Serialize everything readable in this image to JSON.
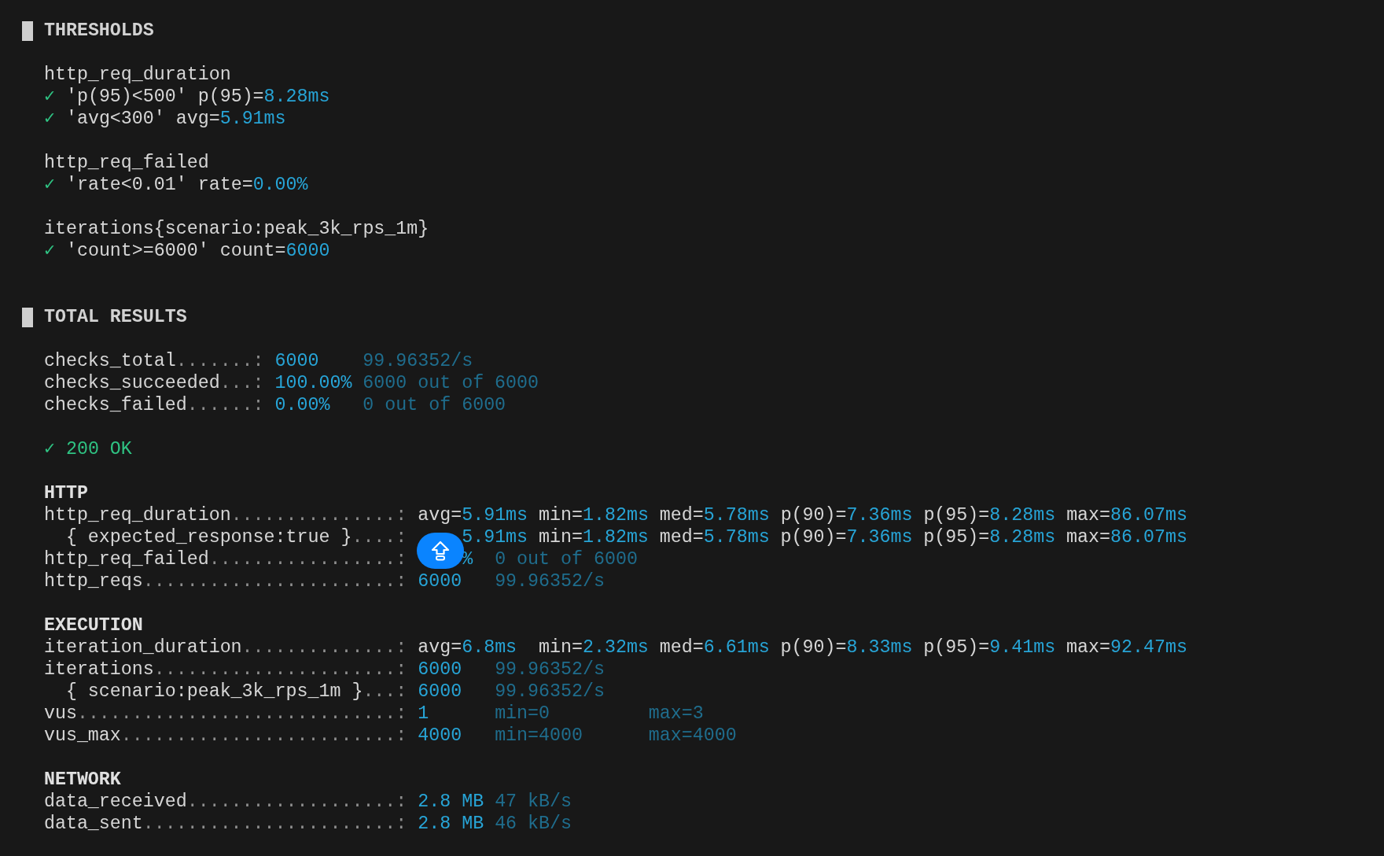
{
  "sections": [
    {
      "kind": "thresholds",
      "title": "THRESHOLDS",
      "metrics": [
        {
          "name": "http_req_duration",
          "checks": [
            {
              "mark": "✓",
              "passed": true,
              "condition": "'p(95)<500'",
              "label": "p(95)=",
              "value": "8.28ms"
            },
            {
              "mark": "✓",
              "passed": true,
              "condition": "'avg<300'",
              "label": "avg=",
              "value": "5.91ms"
            }
          ]
        },
        {
          "name": "http_req_failed",
          "checks": [
            {
              "mark": "✓",
              "passed": true,
              "condition": "'rate<0.01'",
              "label": "rate=",
              "value": "0.00%"
            }
          ]
        },
        {
          "name": "iterations{scenario:peak_3k_rps_1m}",
          "checks": [
            {
              "mark": "✓",
              "passed": true,
              "condition": "'count>=6000'",
              "label": "count=",
              "value": "6000"
            }
          ]
        }
      ]
    },
    {
      "kind": "results",
      "title": "TOTAL RESULTS",
      "summary": [
        {
          "kind": "summary",
          "name": "checks_total",
          "dots": ".......:",
          "cells": [
            {
              "parts": [
                {
                  "kind": "value",
                  "text": "6000"
                }
              ]
            },
            {
              "parts": [
                {
                  "kind": "dim",
                  "text": "99.96352/s"
                }
              ]
            }
          ]
        },
        {
          "kind": "summary",
          "name": "checks_succeeded",
          "dots": "...:",
          "cells": [
            {
              "parts": [
                {
                  "kind": "value",
                  "text": "100.00%"
                }
              ]
            },
            {
              "parts": [
                {
                  "kind": "dim",
                  "text": "6000 out of 6000"
                }
              ]
            }
          ]
        },
        {
          "kind": "summary",
          "name": "checks_failed",
          "dots": "......:",
          "cells": [
            {
              "parts": [
                {
                  "kind": "value",
                  "text": "0.00%"
                }
              ]
            },
            {
              "parts": [
                {
                  "kind": "dim",
                  "text": "0 out of 6000"
                }
              ]
            }
          ]
        }
      ],
      "checks": [
        {
          "mark": "✓",
          "passed": true,
          "label": "200 OK"
        }
      ],
      "groups": [
        {
          "title": "HTTP",
          "metrics": [
            {
              "kind": "trend",
              "name": "http_req_duration",
              "dots": "...............:",
              "cells": [
                {
                  "parts": [
                    {
                      "kind": "label",
                      "text": "avg="
                    },
                    {
                      "kind": "value",
                      "text": "5.91ms"
                    }
                  ]
                },
                {
                  "parts": [
                    {
                      "kind": "label",
                      "text": "min="
                    },
                    {
                      "kind": "value",
                      "text": "1.82ms"
                    }
                  ]
                },
                {
                  "parts": [
                    {
                      "kind": "label",
                      "text": "med="
                    },
                    {
                      "kind": "value",
                      "text": "5.78ms"
                    }
                  ]
                },
                {
                  "parts": [
                    {
                      "kind": "label",
                      "text": "p(90)="
                    },
                    {
                      "kind": "value",
                      "text": "7.36ms"
                    }
                  ]
                },
                {
                  "parts": [
                    {
                      "kind": "label",
                      "text": "p(95)="
                    },
                    {
                      "kind": "value",
                      "text": "8.28ms"
                    }
                  ]
                },
                {
                  "parts": [
                    {
                      "kind": "label",
                      "text": "max="
                    },
                    {
                      "kind": "value",
                      "text": "86.07ms"
                    }
                  ]
                }
              ],
              "children": [
                {
                  "kind": "trend",
                  "name": "{ expected_response:true }",
                  "dots": "....:",
                  "cells": [
                    {
                      "covered": true,
                      "parts": [
                        {
                          "kind": "value",
                          "text": "5.91ms"
                        }
                      ]
                    },
                    {
                      "parts": [
                        {
                          "kind": "label",
                          "text": "min="
                        },
                        {
                          "kind": "value",
                          "text": "1.82ms"
                        }
                      ]
                    },
                    {
                      "parts": [
                        {
                          "kind": "label",
                          "text": "med="
                        },
                        {
                          "kind": "value",
                          "text": "5.78ms"
                        }
                      ]
                    },
                    {
                      "parts": [
                        {
                          "kind": "label",
                          "text": "p(90)="
                        },
                        {
                          "kind": "value",
                          "text": "7.36ms"
                        }
                      ]
                    },
                    {
                      "parts": [
                        {
                          "kind": "label",
                          "text": "p(95)="
                        },
                        {
                          "kind": "value",
                          "text": "8.28ms"
                        }
                      ]
                    },
                    {
                      "parts": [
                        {
                          "kind": "label",
                          "text": "max="
                        },
                        {
                          "kind": "value",
                          "text": "86.07ms"
                        }
                      ]
                    }
                  ]
                }
              ]
            },
            {
              "kind": "counter",
              "name": "http_req_failed",
              "dots": ".................:",
              "cells": [
                {
                  "covered": true,
                  "parts": [
                    {
                      "kind": "value",
                      "text": "%"
                    }
                  ]
                },
                {
                  "parts": [
                    {
                      "kind": "dim",
                      "text": "0 out of 6000"
                    }
                  ]
                }
              ]
            },
            {
              "kind": "counter",
              "name": "http_reqs",
              "dots": ".......................:",
              "cells": [
                {
                  "parts": [
                    {
                      "kind": "value",
                      "text": "6000"
                    }
                  ]
                },
                {
                  "parts": [
                    {
                      "kind": "dim",
                      "text": "99.96352/s"
                    }
                  ]
                }
              ]
            }
          ]
        },
        {
          "title": "EXECUTION",
          "metrics": [
            {
              "kind": "trend",
              "name": "iteration_duration",
              "dots": "..............:",
              "cells": [
                {
                  "parts": [
                    {
                      "kind": "label",
                      "text": "avg="
                    },
                    {
                      "kind": "value",
                      "text": "6.8ms"
                    }
                  ]
                },
                {
                  "parts": [
                    {
                      "kind": "label",
                      "text": "min="
                    },
                    {
                      "kind": "value",
                      "text": "2.32ms"
                    }
                  ]
                },
                {
                  "parts": [
                    {
                      "kind": "label",
                      "text": "med="
                    },
                    {
                      "kind": "value",
                      "text": "6.61ms"
                    }
                  ]
                },
                {
                  "parts": [
                    {
                      "kind": "label",
                      "text": "p(90)="
                    },
                    {
                      "kind": "value",
                      "text": "8.33ms"
                    }
                  ]
                },
                {
                  "parts": [
                    {
                      "kind": "label",
                      "text": "p(95)="
                    },
                    {
                      "kind": "value",
                      "text": "9.41ms"
                    }
                  ]
                },
                {
                  "parts": [
                    {
                      "kind": "label",
                      "text": "max="
                    },
                    {
                      "kind": "value",
                      "text": "92.47ms"
                    }
                  ]
                }
              ]
            },
            {
              "kind": "counter",
              "name": "iterations",
              "dots": "......................:",
              "cells": [
                {
                  "parts": [
                    {
                      "kind": "value",
                      "text": "6000"
                    }
                  ]
                },
                {
                  "parts": [
                    {
                      "kind": "dim",
                      "text": "99.96352/s"
                    }
                  ]
                }
              ],
              "children": [
                {
                  "kind": "counter",
                  "name": "{ scenario:peak_3k_rps_1m }",
                  "dots": "...:",
                  "cells": [
                    {
                      "parts": [
                        {
                          "kind": "value",
                          "text": "6000"
                        }
                      ]
                    },
                    {
                      "parts": [
                        {
                          "kind": "dim",
                          "text": "99.96352/s"
                        }
                      ]
                    }
                  ]
                }
              ]
            },
            {
              "kind": "counter",
              "name": "vus",
              "dots": ".............................:",
              "cells": [
                {
                  "parts": [
                    {
                      "kind": "value",
                      "text": "1"
                    }
                  ]
                },
                {
                  "parts": [
                    {
                      "kind": "dim",
                      "text": "min=0"
                    }
                  ]
                },
                {
                  "parts": [
                    {
                      "kind": "dim",
                      "text": "max=3"
                    }
                  ]
                }
              ]
            },
            {
              "kind": "counter",
              "name": "vus_max",
              "dots": ".........................:",
              "cells": [
                {
                  "parts": [
                    {
                      "kind": "value",
                      "text": "4000"
                    }
                  ]
                },
                {
                  "parts": [
                    {
                      "kind": "dim",
                      "text": "min=4000"
                    }
                  ]
                },
                {
                  "parts": [
                    {
                      "kind": "dim",
                      "text": "max=4000"
                    }
                  ]
                }
              ]
            }
          ]
        },
        {
          "title": "NETWORK",
          "metrics": [
            {
              "kind": "data",
              "name": "data_received",
              "dots": "...................:",
              "cells": [
                {
                  "parts": [
                    {
                      "kind": "value",
                      "text": "2.8 MB"
                    }
                  ]
                },
                {
                  "parts": [
                    {
                      "kind": "dim",
                      "text": "47 kB/s"
                    }
                  ]
                }
              ]
            },
            {
              "kind": "data",
              "name": "data_sent",
              "dots": ".......................:",
              "cells": [
                {
                  "parts": [
                    {
                      "kind": "value",
                      "text": "2.8 MB"
                    }
                  ]
                },
                {
                  "parts": [
                    {
                      "kind": "dim",
                      "text": "46 kB/s"
                    }
                  ]
                }
              ]
            }
          ]
        }
      ]
    }
  ]
}
